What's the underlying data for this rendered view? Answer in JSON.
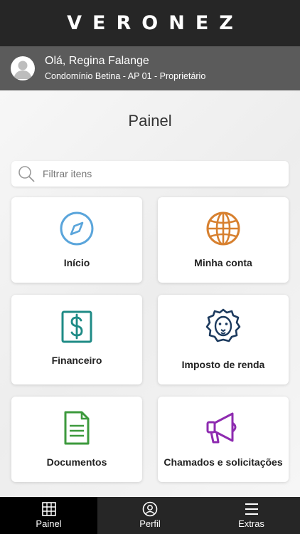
{
  "header": {
    "brand": "VERONEZ"
  },
  "user": {
    "greeting": "Olá, Regina Falange",
    "subtitle": "Condomínio Betina - AP 01 - Proprietário"
  },
  "page": {
    "title": "Painel"
  },
  "search": {
    "placeholder": "Filtrar itens",
    "value": ""
  },
  "cards": [
    {
      "label": "Início",
      "icon": "compass-icon",
      "color": "#5aa5db"
    },
    {
      "label": "Minha conta",
      "icon": "globe-icon",
      "color": "#d7802f"
    },
    {
      "label": "Financeiro",
      "icon": "dollar-icon",
      "color": "#1f8b86"
    },
    {
      "label": "Imposto de renda",
      "icon": "lion-icon",
      "color": "#1c3a5e"
    },
    {
      "label": "Documentos",
      "icon": "document-icon",
      "color": "#3d9a3d"
    },
    {
      "label": "Chamados e solicitações",
      "icon": "megaphone-icon",
      "color": "#8e2bb0"
    }
  ],
  "tabbar": {
    "tabs": [
      {
        "label": "Painel",
        "icon": "grid-icon",
        "active": true
      },
      {
        "label": "Perfil",
        "icon": "user-icon",
        "active": false
      },
      {
        "label": "Extras",
        "icon": "menu-icon",
        "active": false
      }
    ]
  }
}
